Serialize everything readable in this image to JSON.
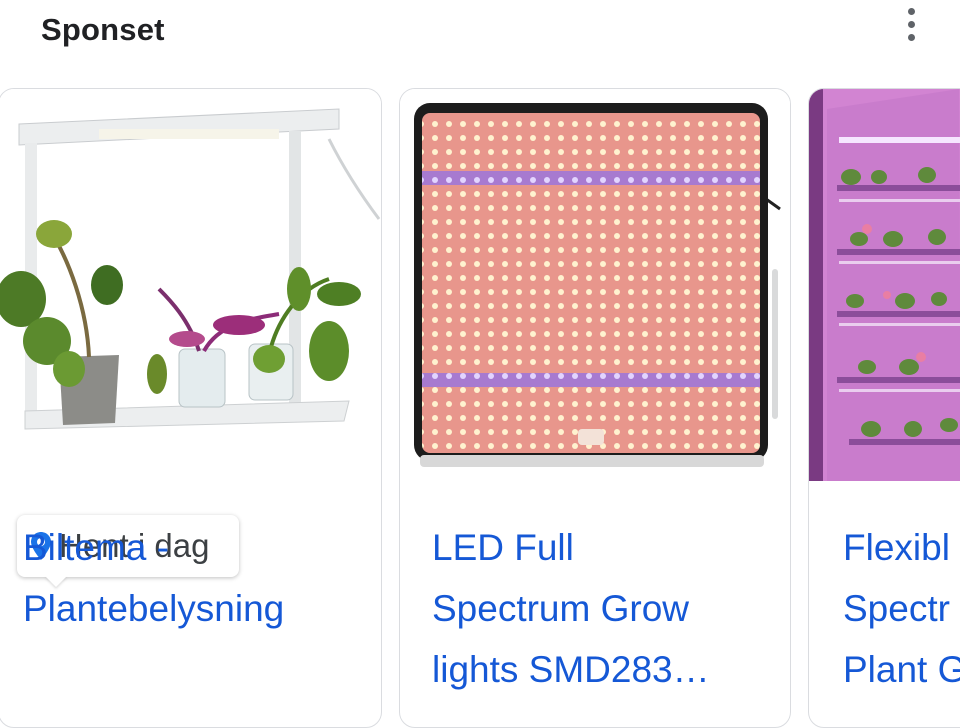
{
  "header": {
    "title": "Sponset"
  },
  "cards": [
    {
      "title": "Biltema -\nPlantebelysning",
      "badge": "Hent i dag"
    },
    {
      "title": "LED Full\nSpectrum Grow\nlights SMD283…"
    },
    {
      "title": "Flexibl\nSpectr\nPlant G"
    }
  ],
  "icons": {
    "more": "more-vert-icon",
    "pin": "location-pin-icon"
  },
  "colors": {
    "link": "#1558d6",
    "pin": "#1a73e8",
    "led_panel": "#e99a90",
    "uv_band": "#9b6ad8",
    "grow_light": "#d77fd0"
  }
}
